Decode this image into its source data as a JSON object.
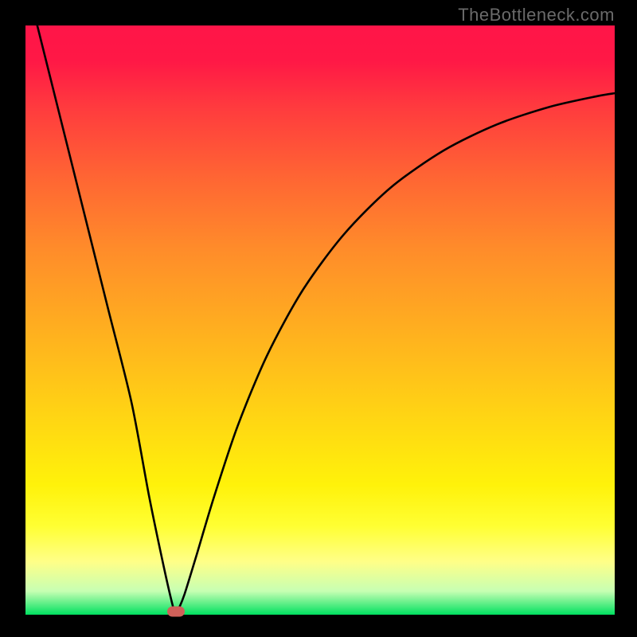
{
  "watermark": "TheBottleneck.com",
  "chart_data": {
    "type": "line",
    "title": "",
    "xlabel": "",
    "ylabel": "",
    "xlim": [
      0,
      100
    ],
    "ylim": [
      0,
      100
    ],
    "grid": false,
    "legend": false,
    "marker": {
      "x": 25.5,
      "y": 0,
      "color": "#cf6059"
    },
    "series": [
      {
        "name": "curve",
        "x": [
          2,
          6,
          10,
          14,
          18,
          21,
          23.5,
          25,
          25.5,
          26,
          27,
          29,
          32,
          36,
          41,
          47,
          54,
          62,
          71,
          80,
          89,
          97,
          100
        ],
        "y": [
          100,
          84,
          68,
          52,
          36,
          20,
          8,
          1.5,
          0.2,
          1,
          3.5,
          10,
          20,
          32,
          44,
          55,
          64.5,
          72.5,
          78.8,
          83.2,
          86.2,
          88,
          88.5
        ]
      }
    ]
  }
}
